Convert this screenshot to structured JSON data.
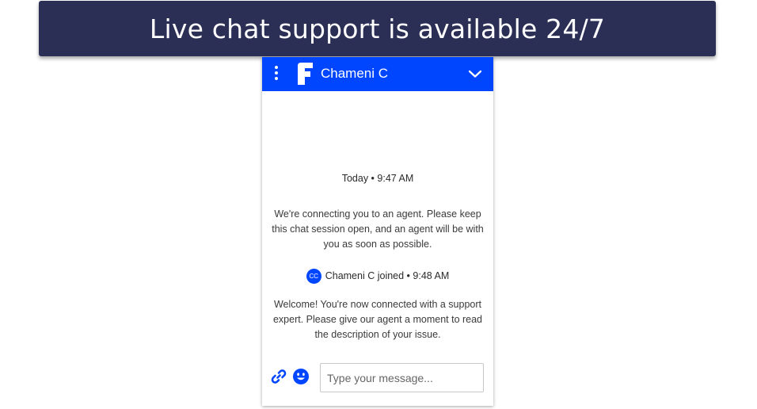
{
  "banner": {
    "text": "Live chat support is available 24/7"
  },
  "chat": {
    "header": {
      "agent_name": "Chameni C",
      "menu_icon": "kebab-menu-icon",
      "logo_icon": "brand-logo-icon",
      "collapse_icon": "chevron-down-icon"
    },
    "timestamp": "Today • 9:47 AM",
    "system_message_1": [
      "We're connecting you to an agent. Please keep",
      "this chat session open, and an agent will be with",
      "you as soon as possible."
    ],
    "join_event": {
      "avatar_initials": "CC",
      "text": "Chameni C joined • 9:48 AM"
    },
    "system_message_2": [
      "Welcome! You're now connected with a support",
      "expert. Please give our agent a moment to read",
      "the description of your issue."
    ],
    "composer": {
      "placeholder": "Type your message...",
      "value": "",
      "attach_icon": "paperclip-icon",
      "emoji_icon": "smiley-icon"
    }
  },
  "colors": {
    "banner_bg": "#2c2f55",
    "header_bg": "#0046ff",
    "accent": "#0046ff"
  }
}
